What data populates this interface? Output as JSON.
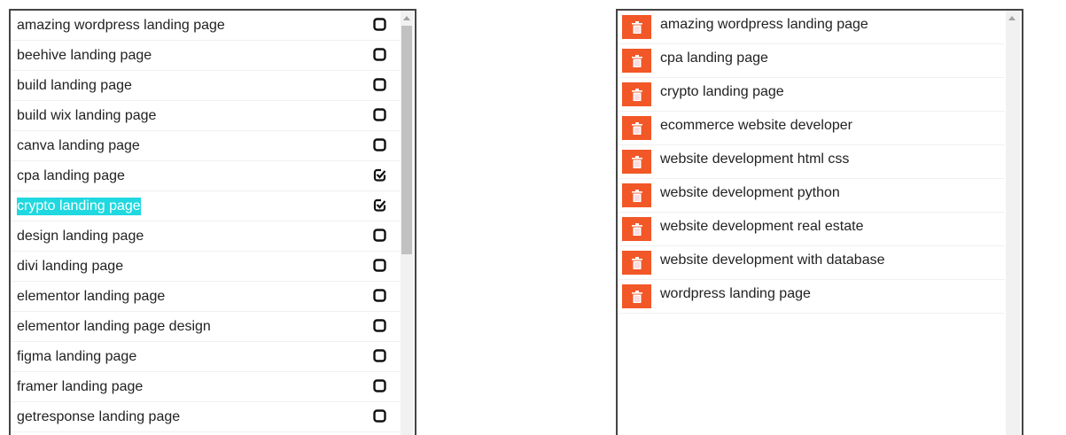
{
  "available": {
    "items": [
      {
        "label": "amazing wordpress landing page",
        "checked": false
      },
      {
        "label": "beehive landing page",
        "checked": false
      },
      {
        "label": "build landing page",
        "checked": false
      },
      {
        "label": "build wix landing page",
        "checked": false
      },
      {
        "label": "canva landing page",
        "checked": false
      },
      {
        "label": "cpa landing page",
        "checked": true
      },
      {
        "label": "crypto landing page",
        "checked": true,
        "highlighted": true
      },
      {
        "label": "design landing page",
        "checked": false
      },
      {
        "label": "divi landing page",
        "checked": false
      },
      {
        "label": "elementor landing page",
        "checked": false
      },
      {
        "label": "elementor landing page design",
        "checked": false
      },
      {
        "label": "figma landing page",
        "checked": false
      },
      {
        "label": "framer landing page",
        "checked": false
      },
      {
        "label": "getresponse landing page",
        "checked": false
      }
    ]
  },
  "selected": {
    "items": [
      {
        "label": "amazing wordpress landing page"
      },
      {
        "label": "cpa landing page"
      },
      {
        "label": "crypto landing page"
      },
      {
        "label": "ecommerce website developer"
      },
      {
        "label": "website development html css"
      },
      {
        "label": "website development python"
      },
      {
        "label": "website development real estate"
      },
      {
        "label": "website development with database"
      },
      {
        "label": "wordpress landing page"
      }
    ]
  },
  "colors": {
    "delete": "#f25727",
    "highlight": "#1fd8e0"
  },
  "icons": {
    "unchecked": "square-outline-icon",
    "checked": "square-check-icon",
    "delete": "trash-icon"
  }
}
